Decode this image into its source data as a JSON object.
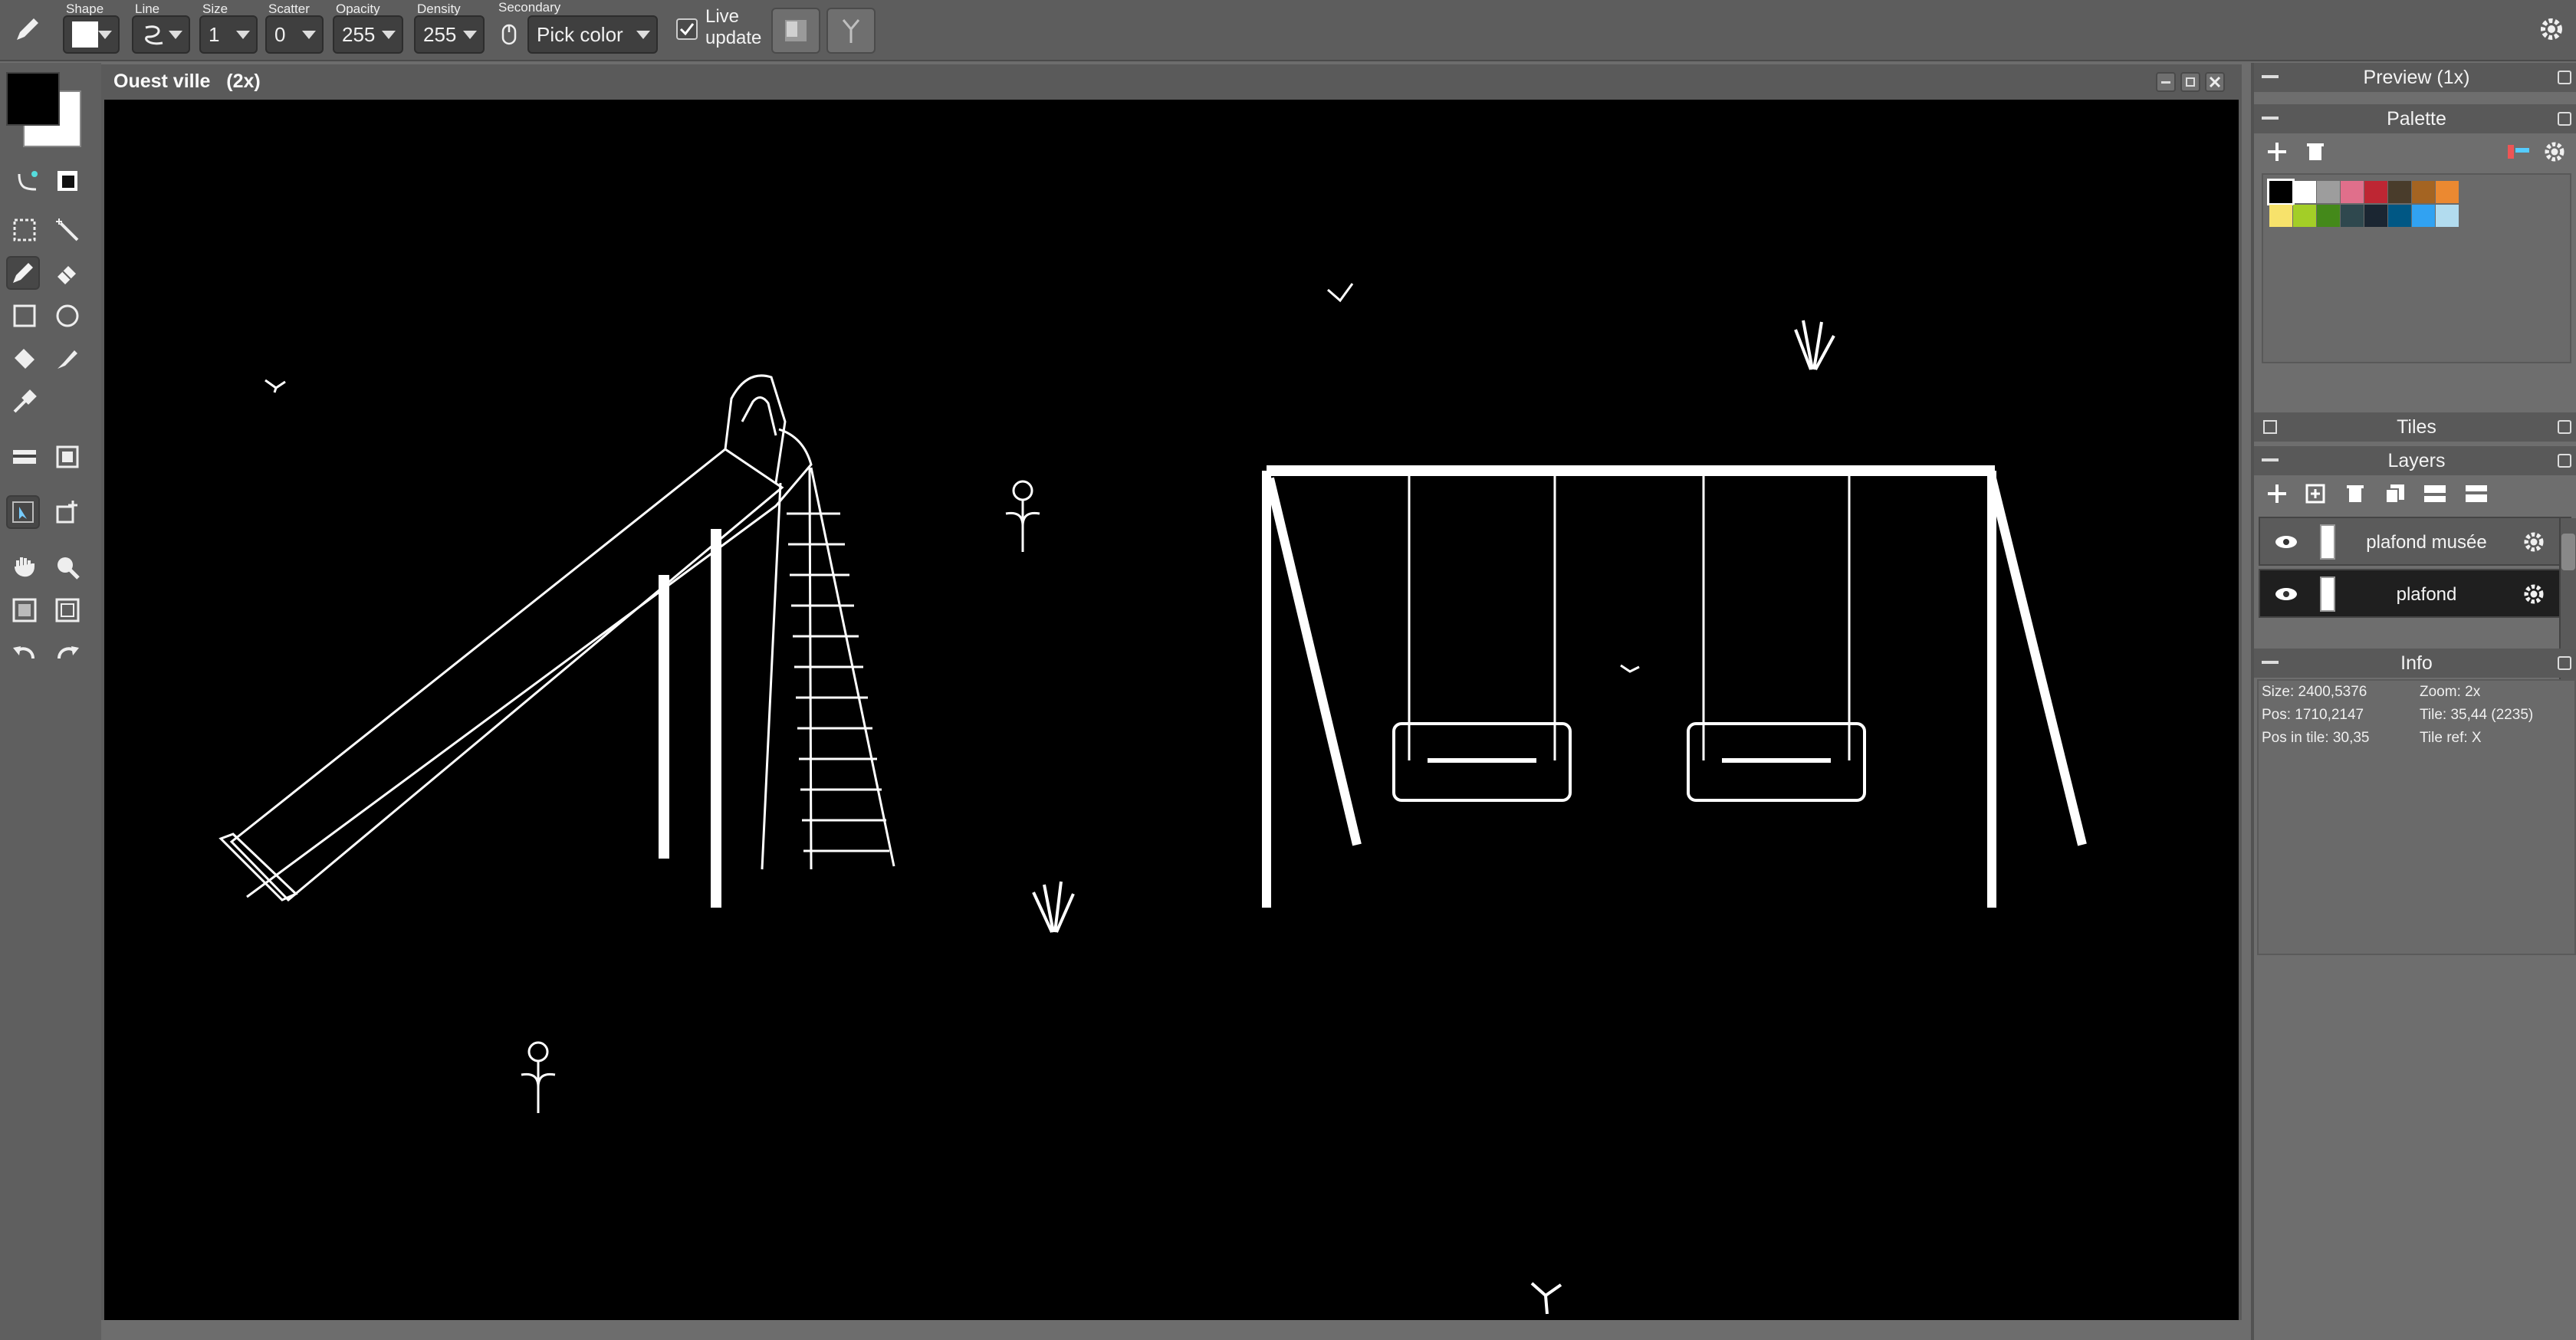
{
  "toolbar": {
    "shape_label": "Shape",
    "line_label": "Line",
    "size_label": "Size",
    "size_value": "1",
    "scatter_label": "Scatter",
    "scatter_value": "0",
    "opacity_label": "Opacity",
    "opacity_value": "255",
    "density_label": "Density",
    "density_value": "255",
    "secondary_label": "Secondary",
    "secondary_value": "Pick color",
    "live_update_line1": "Live",
    "live_update_line2": "update",
    "live_update_checked": true
  },
  "canvas": {
    "title": "Ouest ville   (2x)"
  },
  "panels": {
    "preview": "Preview (1x)",
    "palette": "Palette",
    "tiles": "Tiles",
    "layers": "Layers",
    "info": "Info"
  },
  "palette": {
    "colors": [
      "#000000",
      "#ffffff",
      "#9d9d9d",
      "#e06f8b",
      "#be2633",
      "#493c2b",
      "#a46422",
      "#eb8931",
      "#f7e26b",
      "#a3ce27",
      "#44891a",
      "#2f484e",
      "#1b2632",
      "#005784",
      "#31a2f2",
      "#b2dcef"
    ],
    "selected_index": 0
  },
  "layers": [
    {
      "name": "plafond musée",
      "visible": true,
      "selected": false
    },
    {
      "name": "plafond",
      "visible": true,
      "selected": true
    }
  ],
  "info": {
    "size": "Size: 2400,5376",
    "zoom": "Zoom: 2x",
    "pos": "Pos: 1710,2147",
    "tile": "Tile: 35,44 (2235)",
    "pos_in_tile": "Pos in tile: 30,35",
    "tile_ref": "Tile ref: X"
  },
  "colors": {
    "foreground": "#000000",
    "background": "#ffffff",
    "canvas_bg": "#000000",
    "drawing_stroke": "#ffffff"
  }
}
